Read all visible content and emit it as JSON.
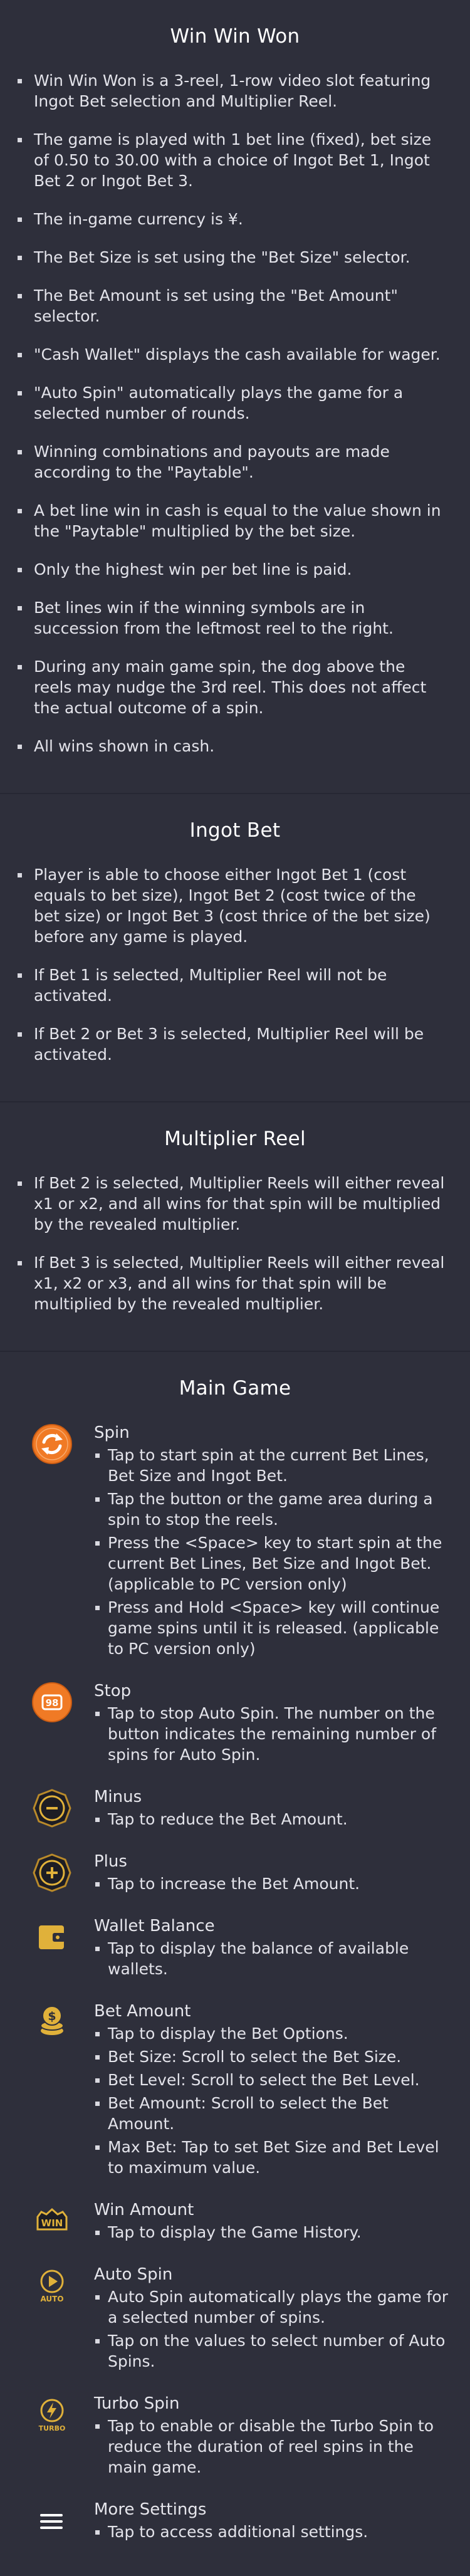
{
  "sections": [
    {
      "title": "Win Win Won",
      "rules": [
        "Win Win Won is a 3-reel, 1-row video slot featuring Ingot Bet selection and Multiplier Reel.",
        "The game is played with 1 bet line (fixed), bet size of 0.50 to 30.00 with a choice of Ingot Bet 1, Ingot Bet 2 or Ingot Bet 3.",
        "The in-game currency is ¥.",
        "The Bet Size is set using the \"Bet Size\" selector.",
        "The Bet Amount is set using the \"Bet Amount\" selector.",
        "\"Cash Wallet\" displays the cash available for wager.",
        "\"Auto Spin\" automatically plays the game for a selected number of rounds.",
        "Winning combinations and payouts are made according to the \"Paytable\".",
        "A bet line win in cash is equal to the value shown in the \"Paytable\" multiplied by the bet size.",
        "Only the highest win per bet line is paid.",
        "Bet lines win if the winning symbols are in succession from the leftmost reel to the right.",
        "During any main game spin, the dog above the reels may nudge the 3rd reel. This does not affect the actual outcome of a spin.",
        "All wins shown in cash."
      ]
    },
    {
      "title": "Ingot Bet",
      "rules": [
        "Player is able to choose either Ingot Bet 1 (cost equals to bet size), Ingot Bet 2 (cost twice of the bet size) or Ingot Bet 3 (cost thrice of the bet size) before any game is played.",
        "If Bet 1 is selected, Multiplier Reel will not be activated.",
        "If Bet 2 or Bet 3 is selected, Multiplier Reel will be activated."
      ]
    },
    {
      "title": "Multiplier Reel",
      "rules": [
        "If Bet 2 is selected, Multiplier Reels will either reveal x1 or x2, and all wins for that spin will be multiplied by the revealed multiplier.",
        "If Bet 3 is selected, Multiplier Reels will either reveal x1, x2 or x3, and all wins for that spin will be multiplied by the revealed multiplier."
      ]
    }
  ],
  "main_game": {
    "title": "Main Game",
    "items": [
      {
        "icon": "spin-icon",
        "name": "Spin",
        "lines": [
          "Tap to start spin at the current Bet Lines, Bet Size and Ingot Bet.",
          "Tap the button or the game area during a spin to stop the reels.",
          "Press the <Space> key to start spin at the current Bet Lines, Bet Size and Ingot Bet. (applicable to PC version only)",
          "Press and Hold <Space> key will continue game spins until it is released. (applicable to PC version only)"
        ]
      },
      {
        "icon": "stop-icon",
        "icon_text": "98",
        "name": "Stop",
        "lines": [
          "Tap to stop Auto Spin. The number on the button indicates the remaining number of spins for Auto Spin."
        ]
      },
      {
        "icon": "minus-icon",
        "name": "Minus",
        "lines": [
          "Tap to reduce the Bet Amount."
        ]
      },
      {
        "icon": "plus-icon",
        "name": "Plus",
        "lines": [
          "Tap to increase the Bet Amount."
        ]
      },
      {
        "icon": "wallet-icon",
        "name": "Wallet Balance",
        "lines": [
          "Tap to display the balance of available wallets."
        ]
      },
      {
        "icon": "coins-icon",
        "name": "Bet Amount",
        "lines": [
          "Tap to display the Bet Options.",
          "Bet Size: Scroll to select the Bet Size.",
          "Bet Level: Scroll to select the Bet Level.",
          "Bet Amount: Scroll to select the Bet Amount.",
          "Max Bet: Tap to set Bet Size and Bet Level to maximum value."
        ]
      },
      {
        "icon": "win-icon",
        "icon_text": "WIN",
        "name": "Win Amount",
        "lines": [
          "Tap to display the Game History."
        ]
      },
      {
        "icon": "auto-spin-icon",
        "icon_text": "AUTO",
        "name": "Auto Spin",
        "lines": [
          "Auto Spin automatically plays the game for a selected number of spins.",
          "Tap on the values to select number of Auto Spins."
        ]
      },
      {
        "icon": "turbo-icon",
        "icon_text": "TURBO",
        "name": "Turbo Spin",
        "lines": [
          "Tap to enable or disable the Turbo Spin to reduce the duration of reel spins in the main game."
        ]
      },
      {
        "icon": "menu-icon",
        "name": "More Settings",
        "lines": [
          "Tap to access additional settings."
        ]
      }
    ]
  },
  "colors": {
    "background": "#2e2f3b",
    "gold": "#e0b13a",
    "orange": "#f07a25"
  }
}
